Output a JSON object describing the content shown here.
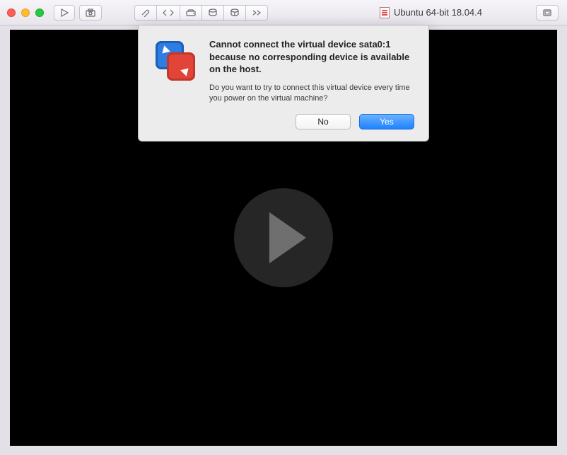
{
  "window": {
    "title": "Ubuntu 64-bit 18.04.4"
  },
  "dialog": {
    "heading": "Cannot connect the virtual device sata0:1 because no corresponding device is available on the host.",
    "body": "Do you want to try to connect this virtual device every time you power on the virtual machine?",
    "no_label": "No",
    "yes_label": "Yes"
  },
  "icons": {
    "play": "play-icon",
    "snapshot": "snapshot-icon",
    "wrench": "wrench-icon",
    "code": "code-icon",
    "drive": "drive-icon",
    "disk1": "disk-icon",
    "disk2": "disk-icon",
    "more": "more-icon",
    "expand": "expand-icon",
    "doc": "vm-doc-icon"
  }
}
